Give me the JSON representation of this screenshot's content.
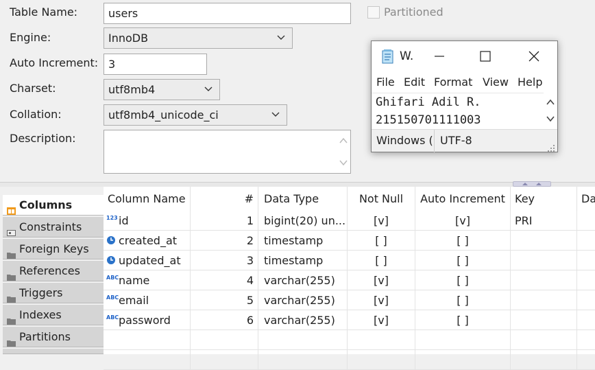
{
  "form": {
    "table_name_label": "Table Name:",
    "table_name_value": "users",
    "partitioned_label": "Partitioned",
    "engine_label": "Engine:",
    "engine_value": "InnoDB",
    "auto_increment_label": "Auto Increment:",
    "auto_increment_value": "3",
    "charset_label": "Charset:",
    "charset_value": "utf8mb4",
    "collation_label": "Collation:",
    "collation_value": "utf8mb4_unicode_ci",
    "description_label": "Description:",
    "description_value": ""
  },
  "tabs": [
    {
      "label": "Columns",
      "active": true
    },
    {
      "label": "Constraints"
    },
    {
      "label": "Foreign Keys"
    },
    {
      "label": "References"
    },
    {
      "label": "Triggers"
    },
    {
      "label": "Indexes"
    },
    {
      "label": "Partitions"
    }
  ],
  "grid": {
    "headers": [
      "Column Name",
      "#",
      "Data Type",
      "Not Null",
      "Auto Increment",
      "Key",
      "Da"
    ],
    "rows": [
      {
        "icon": "number-type-icon",
        "name": "id",
        "num": "1",
        "type": "bigint(20) un...",
        "not_null": "[v]",
        "auto_inc": "[v]",
        "key": "PRI"
      },
      {
        "icon": "clock-icon",
        "name": "created_at",
        "num": "2",
        "type": "timestamp",
        "not_null": "[ ]",
        "auto_inc": "[ ]",
        "key": ""
      },
      {
        "icon": "clock-icon",
        "name": "updated_at",
        "num": "3",
        "type": "timestamp",
        "not_null": "[ ]",
        "auto_inc": "[ ]",
        "key": ""
      },
      {
        "icon": "text-type-icon",
        "name": "name",
        "num": "4",
        "type": "varchar(255)",
        "not_null": "[v]",
        "auto_inc": "[ ]",
        "key": ""
      },
      {
        "icon": "text-type-icon",
        "name": "email",
        "num": "5",
        "type": "varchar(255)",
        "not_null": "[v]",
        "auto_inc": "[ ]",
        "key": ""
      },
      {
        "icon": "text-type-icon",
        "name": "password",
        "num": "6",
        "type": "varchar(255)",
        "not_null": "[v]",
        "auto_inc": "[ ]",
        "key": ""
      }
    ]
  },
  "notepad": {
    "title": "W.",
    "menu": [
      "File",
      "Edit",
      "Format",
      "View",
      "Help"
    ],
    "text_line1": "Ghifari Adil R.",
    "text_line2": "215150701111003",
    "status_eol": "Windows (",
    "status_encoding": "UTF-8"
  },
  "icons": {
    "number_type": "123",
    "text_type": "ABC"
  }
}
